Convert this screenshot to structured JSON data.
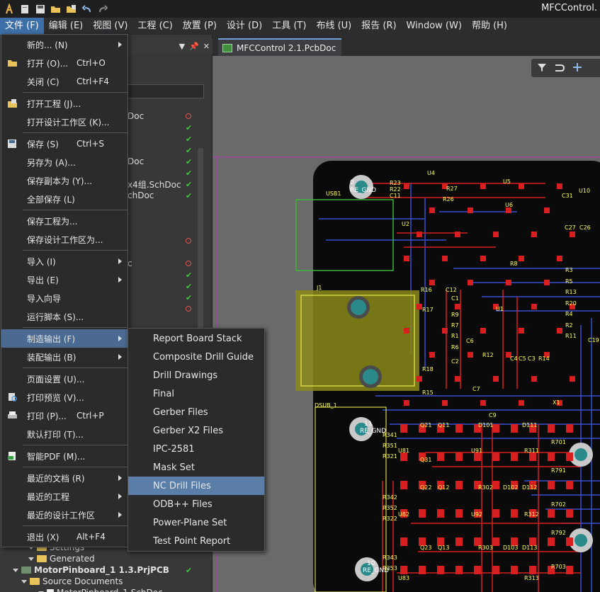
{
  "app": {
    "title": "MFCControl."
  },
  "menubar": [
    {
      "label": "文件 (F)",
      "active": true
    },
    {
      "label": "编辑 (E)"
    },
    {
      "label": "视图 (V)"
    },
    {
      "label": "工程 (C)"
    },
    {
      "label": "放置 (P)"
    },
    {
      "label": "设计 (D)"
    },
    {
      "label": "工具 (T)"
    },
    {
      "label": "布线 (U)"
    },
    {
      "label": "报告 (R)"
    },
    {
      "label": "Window (W)"
    },
    {
      "label": "帮助 (H)"
    }
  ],
  "doc_tab": {
    "label": "MFCControl 2.1.PcbDoc"
  },
  "file_menu": [
    {
      "label": "新的... (N)",
      "arrow": true,
      "icon": "none"
    },
    {
      "label": "打开 (O)...",
      "shortcut": "Ctrl+O",
      "icon": "open-folder-icon"
    },
    {
      "label": "关闭 (C)",
      "shortcut": "Ctrl+F4",
      "icon": "none"
    },
    {
      "sep": true
    },
    {
      "label": "打开工程 (J)...",
      "icon": "open-project-icon"
    },
    {
      "label": "打开设计工作区 (K)...",
      "icon": "none"
    },
    {
      "sep": true
    },
    {
      "label": "保存 (S)",
      "shortcut": "Ctrl+S",
      "icon": "save-icon"
    },
    {
      "label": "另存为 (A)...",
      "icon": "none"
    },
    {
      "label": "保存副本为 (Y)...",
      "icon": "none"
    },
    {
      "label": "全部保存 (L)",
      "icon": "none"
    },
    {
      "sep": true
    },
    {
      "label": "保存工程为...",
      "icon": "none"
    },
    {
      "label": "保存设计工作区为...",
      "icon": "none"
    },
    {
      "sep": true
    },
    {
      "label": "导入 (I)",
      "arrow": true,
      "icon": "none"
    },
    {
      "label": "导出 (E)",
      "arrow": true,
      "icon": "none"
    },
    {
      "label": "导入向导",
      "icon": "none"
    },
    {
      "label": "运行脚本 (S)...",
      "icon": "none"
    },
    {
      "sep": true
    },
    {
      "label": "制造输出 (F)",
      "arrow": true,
      "highlighted": true,
      "icon": "none"
    },
    {
      "label": "装配输出 (B)",
      "arrow": true,
      "icon": "none"
    },
    {
      "sep": true
    },
    {
      "label": "页面设置 (U)...",
      "icon": "none"
    },
    {
      "label": "打印预览 (V)...",
      "icon": "print-preview-icon"
    },
    {
      "label": "打印 (P)...",
      "shortcut": "Ctrl+P",
      "icon": "print-icon"
    },
    {
      "label": "默认打印 (T)...",
      "icon": "none"
    },
    {
      "sep": true
    },
    {
      "label": "智能PDF (M)...",
      "icon": "pdf-icon"
    },
    {
      "sep": true
    },
    {
      "label": "最近的文档 (R)",
      "arrow": true,
      "icon": "none"
    },
    {
      "label": "最近的工程",
      "arrow": true,
      "icon": "none"
    },
    {
      "label": "最近的设计工作区",
      "arrow": true,
      "icon": "none"
    },
    {
      "sep": true
    },
    {
      "label": "退出 (X)",
      "shortcut": "Alt+F4",
      "icon": "none"
    }
  ],
  "sub_menu": [
    {
      "label": "Report Board Stack"
    },
    {
      "label": "Composite Drill Guide"
    },
    {
      "label": "Drill Drawings"
    },
    {
      "label": "Final"
    },
    {
      "label": "Gerber Files"
    },
    {
      "label": "Gerber X2 Files"
    },
    {
      "label": "IPC-2581"
    },
    {
      "label": "Mask Set"
    },
    {
      "label": "NC Drill Files",
      "highlighted": true
    },
    {
      "label": "ODB++ Files"
    },
    {
      "label": "Power-Plane Set"
    },
    {
      "label": "Test Point Report"
    }
  ],
  "project_panel": {
    "partial_rows": [
      {
        "text": "Doc",
        "status": "modified"
      },
      {
        "text": "",
        "status": "ok"
      },
      {
        "text": "",
        "status": "ok"
      },
      {
        "text": "",
        "status": "ok"
      },
      {
        "text": "Doc",
        "status": "ok"
      },
      {
        "text": "",
        "status": "ok"
      },
      {
        "text": "x4组.SchDoc",
        "status": "ok"
      },
      {
        "text": "chDoc",
        "status": "ok"
      },
      {
        "text": "",
        "status": "none"
      },
      {
        "text": "",
        "status": "none"
      },
      {
        "text": "",
        "status": "none"
      },
      {
        "text": "",
        "status": "modified"
      },
      {
        "text": "",
        "status": "none"
      },
      {
        "text": "c",
        "status": "modified"
      },
      {
        "text": "",
        "status": "ok"
      },
      {
        "text": "",
        "status": "ok"
      },
      {
        "text": "",
        "status": "ok"
      },
      {
        "text": "",
        "status": "modified"
      }
    ],
    "tree_bottom": [
      {
        "label": "Settings",
        "indent": 40,
        "kind": "folder",
        "status": "none"
      },
      {
        "label": "Generated",
        "indent": 40,
        "kind": "folder",
        "status": "none"
      },
      {
        "label": "MotorPinboard_1 1.3.PrjPCB",
        "indent": 18,
        "kind": "project",
        "status": "ok"
      },
      {
        "label": "Source Documents",
        "indent": 30,
        "kind": "folder",
        "status": "none"
      },
      {
        "label": "MotorPinboard_1.SchDoc",
        "indent": 54,
        "kind": "doc",
        "status": "none"
      }
    ]
  },
  "pcb_labels": {
    "components": [
      "USB1",
      "U2",
      "U4",
      "U5",
      "U6",
      "U10",
      "R23",
      "R22",
      "C11",
      "R26",
      "C31",
      "J1",
      "R16",
      "C12",
      "C1",
      "R3",
      "R5",
      "R13",
      "R20",
      "R4",
      "R2",
      "R11",
      "R7",
      "R1",
      "R6",
      "C2",
      "R12",
      "C4",
      "C5",
      "C3",
      "R14",
      "C7",
      "R8",
      "C9",
      "C19",
      "R15",
      "R18",
      "U1",
      "R9",
      "C6",
      "R17",
      "DSUB_1",
      "X1",
      "Q21",
      "Q11",
      "Q31",
      "D101",
      "D111",
      "R341",
      "R351",
      "R321",
      "U81",
      "U91",
      "R311",
      "R701",
      "R791",
      "Q22",
      "Q12",
      "R302",
      "D102",
      "D112",
      "R342",
      "R352",
      "R322",
      "U82",
      "U92",
      "R312",
      "R702",
      "R792",
      "Q23",
      "Q13",
      "R303",
      "D103",
      "D113",
      "R343",
      "R353",
      "U83",
      "R313",
      "R703",
      "C27",
      "C26",
      "R27"
    ],
    "pads": [
      "0",
      "RE_GND",
      "11",
      "RE_GND",
      "10",
      "RE_GND"
    ]
  },
  "colors": {
    "board": "#0a0a0a",
    "copper_top": "#d81f1f",
    "copper_bottom": "#3a4fd0",
    "overlay": "#ffff55",
    "keepout": "#b23fb2",
    "menu_bg": "#2b2b2b",
    "highlight": "#4a6a91"
  }
}
